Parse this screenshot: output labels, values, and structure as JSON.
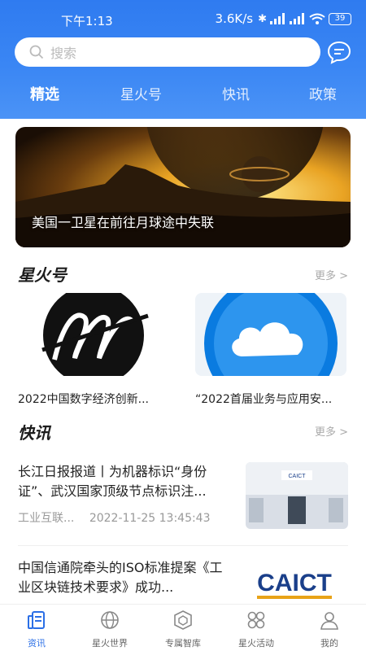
{
  "status": {
    "time": "下午1:13",
    "speed": "3.6K/s",
    "battery": "39"
  },
  "search": {
    "placeholder": "搜索"
  },
  "tabs": [
    "精选",
    "星火号",
    "快讯",
    "政策"
  ],
  "banner": {
    "title": "美国一卫星在前往月球途中失联"
  },
  "section_xinghuo": {
    "title": "星火号",
    "more": "更多 >"
  },
  "cards": [
    {
      "caption": "2022中国数字经济创新..."
    },
    {
      "caption": "“2022首届业务与应用安..."
    }
  ],
  "section_kuaixun": {
    "title": "快讯",
    "more": "更多 >"
  },
  "news": [
    {
      "title": "长江日报报道丨为机器标识“身份证”、武汉国家顶级节点标识注...",
      "source": "工业互联...",
      "time": "2022-11-25 13:45:43",
      "image_text": "CAICT"
    },
    {
      "title": "中国信通院牵头的ISO标准提案《工业区块链技术要求》成功...",
      "image_text": "CAICT"
    }
  ],
  "bottom_nav": [
    "资讯",
    "星火世界",
    "专属智库",
    "星火活动",
    "我的"
  ],
  "colors": {
    "accent": "#2f7bf0",
    "active_nav": "#2b6fe6"
  }
}
